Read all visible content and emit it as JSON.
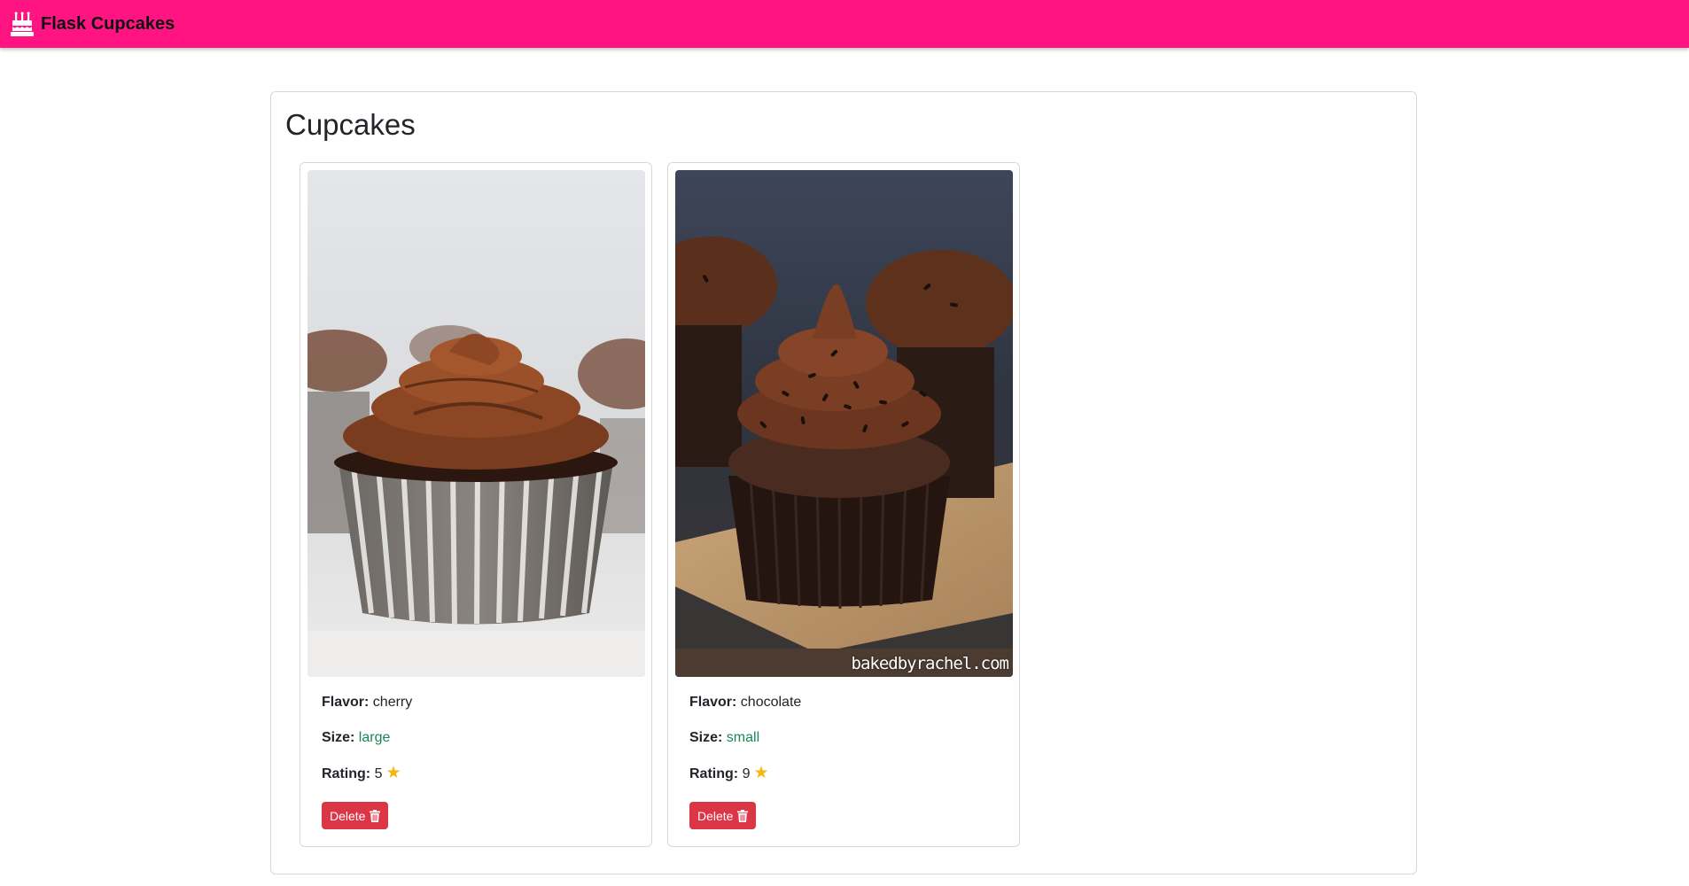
{
  "navbar": {
    "brand_text": "Flask Cupcakes",
    "brand_icon": "cake-icon",
    "background": "#ff1481"
  },
  "page": {
    "title": "Cupcakes"
  },
  "cupcakes": [
    {
      "flavor_label": "Flavor:",
      "flavor": "cherry",
      "size_label": "Size:",
      "size": "large",
      "rating_label": "Rating:",
      "rating": "5",
      "rating_icon": "star-icon",
      "delete_label": "Delete",
      "delete_icon": "trash-icon"
    },
    {
      "flavor_label": "Flavor:",
      "flavor": "chocolate",
      "size_label": "Size:",
      "size": "small",
      "rating_label": "Rating:",
      "rating": "9",
      "rating_icon": "star-icon",
      "delete_label": "Delete",
      "delete_icon": "trash-icon",
      "image_watermark": "bakedbyrachel.com"
    }
  ],
  "colors": {
    "delete_button": "#dc3545",
    "size_value": "#198754",
    "star": "#f5b60d"
  }
}
